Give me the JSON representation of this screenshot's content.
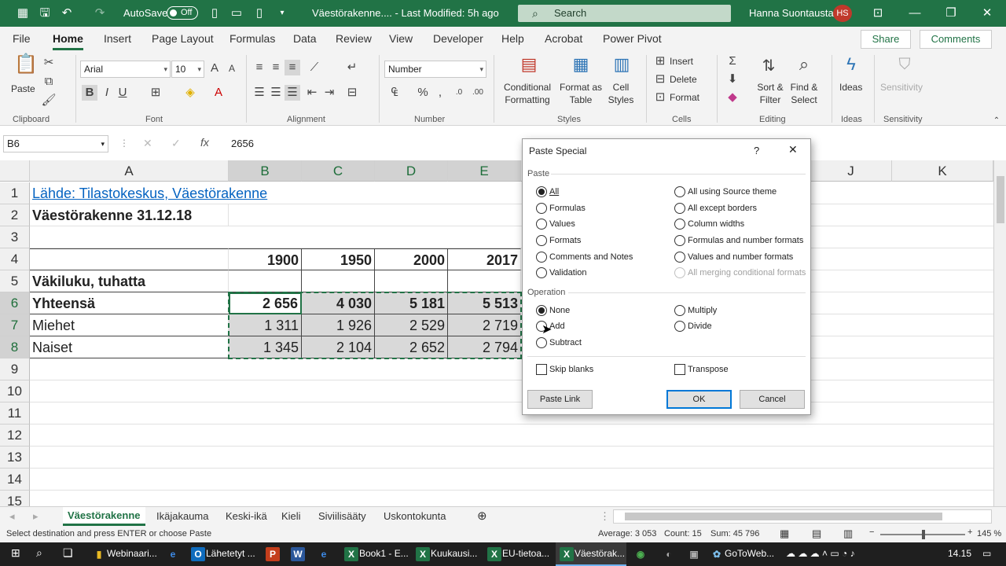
{
  "titlebar": {
    "autosave_label": "AutoSave",
    "autosave_state": "Off",
    "doc_title": "Väestörakenne....  -  Last Modified: 5h ago",
    "search_placeholder": "Search",
    "user_name": "Hanna Suontausta",
    "user_initials": "HS"
  },
  "ribbon_tabs": [
    "File",
    "Home",
    "Insert",
    "Page Layout",
    "Formulas",
    "Data",
    "Review",
    "View",
    "Developer",
    "Help",
    "Acrobat",
    "Power Pivot"
  ],
  "ribbon_actions": {
    "share": "Share",
    "comments": "Comments"
  },
  "ribbon": {
    "clipboard": {
      "paste": "Paste",
      "label": "Clipboard"
    },
    "font": {
      "name": "Arial",
      "size": "10",
      "label": "Font",
      "bold": "B",
      "italic": "I",
      "underline": "U"
    },
    "alignment": {
      "label": "Alignment"
    },
    "number": {
      "format": "Number",
      "label": "Number"
    },
    "styles": {
      "cond1": "Conditional",
      "cond2": "Formatting",
      "fmt1": "Format as",
      "fmt2": "Table",
      "cell1": "Cell",
      "cell2": "Styles",
      "label": "Styles"
    },
    "cells": {
      "insert": "Insert",
      "delete": "Delete",
      "format": "Format",
      "label": "Cells"
    },
    "editing": {
      "sort1": "Sort &",
      "sort2": "Filter",
      "find1": "Find &",
      "find2": "Select",
      "label": "Editing"
    },
    "ideas": {
      "btn": "Ideas",
      "label": "Ideas"
    },
    "sensitivity": {
      "btn": "Sensitivity",
      "label": "Sensitivity"
    }
  },
  "formula_bar": {
    "name_box": "B6",
    "fx": "fx",
    "value": "2656"
  },
  "columns": [
    "A",
    "B",
    "C",
    "D",
    "E",
    "J",
    "K"
  ],
  "rows": [
    "1",
    "2",
    "3",
    "4",
    "5",
    "6",
    "7",
    "8",
    "9",
    "10",
    "11",
    "12",
    "13",
    "14",
    "15"
  ],
  "cells": {
    "a1": "Lähde: Tilastokeskus, Väestörakenne",
    "a2": "Väestörakenne 31.12.18",
    "a5": "Väkiluku, tuhatta",
    "a6": "Yhteensä",
    "a7": "Miehet",
    "a8": "Naiset",
    "years": [
      "1900",
      "1950",
      "2000",
      "2017"
    ],
    "row6": [
      "2 656",
      "4 030",
      "5 181",
      "5 513"
    ],
    "row7": [
      "1 311",
      "1 926",
      "2 529",
      "2 719"
    ],
    "row8": [
      "1 345",
      "2 104",
      "2 652",
      "2 794"
    ]
  },
  "sheet_tabs": [
    "Väestörakenne",
    "Ikäjakauma",
    "Keski-ikä",
    "Kieli",
    "Siviilisääty",
    "Uskontokunta"
  ],
  "status": {
    "message": "Select destination and press ENTER or choose Paste",
    "average": "Average: 3 053",
    "count": "Count: 15",
    "sum": "Sum: 45 796",
    "zoom": "145 %"
  },
  "taskbar": {
    "items": [
      "Webinaari...",
      "Lähetetyt ...",
      "Book1 - E...",
      "Kuukausi...",
      "EU-tietoa...",
      "Väestörak...",
      "GoToWeb..."
    ],
    "time": "14.15"
  },
  "dialog": {
    "title": "Paste Special",
    "help": "?",
    "paste_section": "Paste",
    "paste_left": [
      "All",
      "Formulas",
      "Values",
      "Formats",
      "Comments and Notes",
      "Validation"
    ],
    "paste_right": [
      "All using Source theme",
      "All except borders",
      "Column widths",
      "Formulas and number formats",
      "Values and number formats",
      "All merging conditional formats"
    ],
    "operation_section": "Operation",
    "op_left": [
      "None",
      "Add",
      "Subtract"
    ],
    "op_right": [
      "Multiply",
      "Divide"
    ],
    "skip_blanks": "Skip blanks",
    "transpose": "Transpose",
    "paste_link": "Paste Link",
    "ok": "OK",
    "cancel": "Cancel"
  }
}
